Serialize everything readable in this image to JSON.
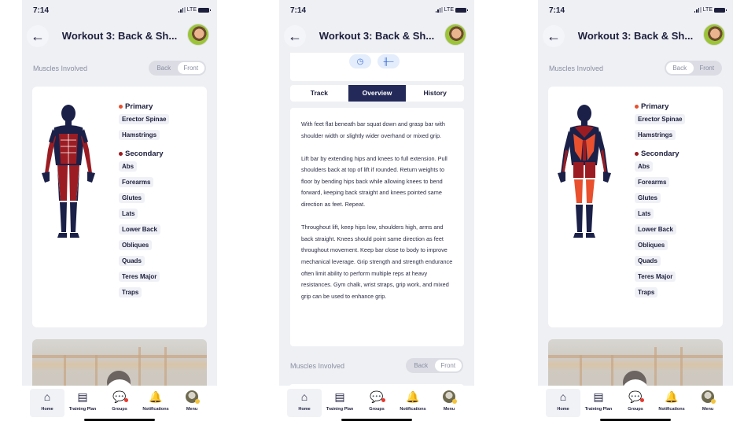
{
  "status": {
    "time": "7:14",
    "network": "LTE"
  },
  "header": {
    "back_icon": "←",
    "title": "Workout 3: Back & Sh..."
  },
  "muscles": {
    "label": "Muscles Involved",
    "toggle": {
      "back": "Back",
      "front": "Front"
    },
    "primary_label": "Primary",
    "secondary_label": "Secondary",
    "primary_color": "#e8502e",
    "secondary_color": "#9b1c22",
    "primary": [
      "Erector Spinae",
      "Hamstrings"
    ],
    "secondary": [
      "Abs",
      "Forearms",
      "Glutes",
      "Lats",
      "Lower Back",
      "Obliques",
      "Quads",
      "Teres Major",
      "Traps"
    ]
  },
  "screens": [
    {
      "toggle_active": "Front",
      "figure_view": "front"
    },
    {
      "toggle_active": "Front"
    },
    {
      "toggle_active": "Back",
      "figure_view": "back"
    }
  ],
  "exercise": {
    "icons": [
      "timer-icon",
      "dumbbell-icon"
    ],
    "tabs": [
      "Track",
      "Overview",
      "History"
    ],
    "active_tab": "Overview",
    "paragraphs": [
      "With feet flat beneath bar squat down and grasp bar with shoulder width or slightly wider overhand or mixed grip.",
      "Lift bar by extending hips and knees to full extension. Pull shoulders back at top of lift if rounded. Return weights to floor by bending hips back while allowing knees to bend forward, keeping back straight and knees pointed same direction as feet. Repeat.",
      "Throughout lift, keep hips low, shoulders high, arms and back straight. Knees should point same direction as feet throughout movement. Keep bar close to body to improve mechanical leverage. Grip strength and strength endurance often limit ability to perform multiple reps at heavy resistances. Gym chalk, wrist straps, grip work, and mixed grip can be used to enhance grip."
    ]
  },
  "tabbar": {
    "items": [
      {
        "label": "Home",
        "icon": "⌂"
      },
      {
        "label": "Training Plan",
        "icon": "▤"
      },
      {
        "label": "Groups",
        "icon": "💬"
      },
      {
        "label": "Notifications",
        "icon": "🔔"
      },
      {
        "label": "Menu",
        "icon": ""
      }
    ],
    "active": "Home"
  }
}
